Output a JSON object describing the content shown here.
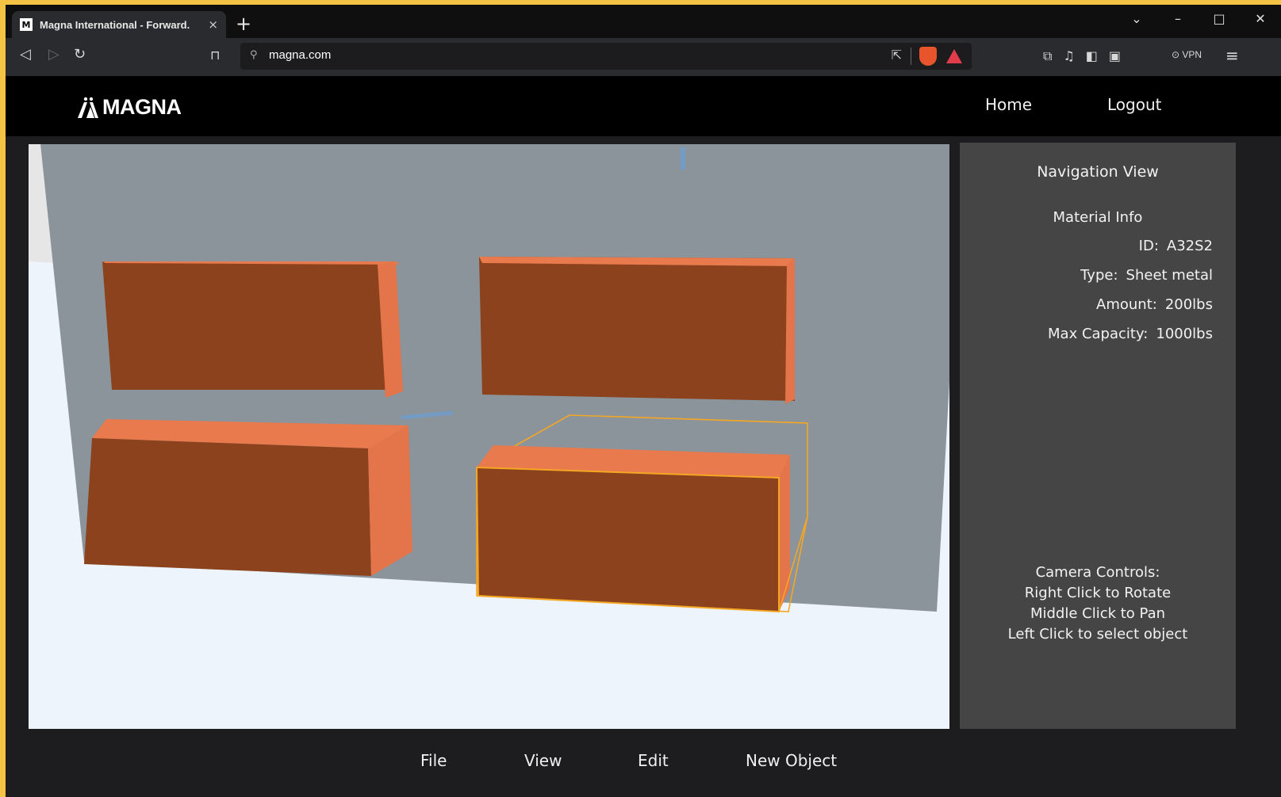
{
  "browser": {
    "tab_title": "Magna International - Forward.",
    "tab_close": "×",
    "new_tab": "+",
    "url": "magna.com",
    "vpn_label": "VPN",
    "window_controls": {
      "dropdown": "⌄",
      "minimize": "–",
      "maximize": "□",
      "close": "✕"
    }
  },
  "header": {
    "logo_text": "MAGNA",
    "nav": {
      "home": "Home",
      "logout": "Logout"
    }
  },
  "panel": {
    "title": "Navigation View",
    "material_info_label": "Material Info",
    "fields": [
      {
        "label": "ID:",
        "value": "A32S2"
      },
      {
        "label": "Type:",
        "value": "Sheet metal"
      },
      {
        "label": "Amount:",
        "value": "200lbs"
      },
      {
        "label": "Max Capacity:",
        "value": "1000lbs"
      }
    ],
    "camera_controls": {
      "title": "Camera Controls:",
      "lines": [
        "Right Click to Rotate",
        "Middle Click to Pan",
        "Left Click to select object"
      ]
    }
  },
  "menu": {
    "file": "File",
    "view": "View",
    "edit": "Edit",
    "new_object": "New Object"
  },
  "colors": {
    "box_front": "#8b421d",
    "box_light": "#e87a4d",
    "box_side": "#e4744a",
    "wall": "#8b949b",
    "floor": "#eef4fb",
    "selection": "#f5a623",
    "panel_bg": "#454545"
  },
  "scene": {
    "selected_box": "box-bottom-right",
    "boxes": [
      "box-top-left",
      "box-top-right",
      "box-bottom-left",
      "box-bottom-right"
    ]
  }
}
